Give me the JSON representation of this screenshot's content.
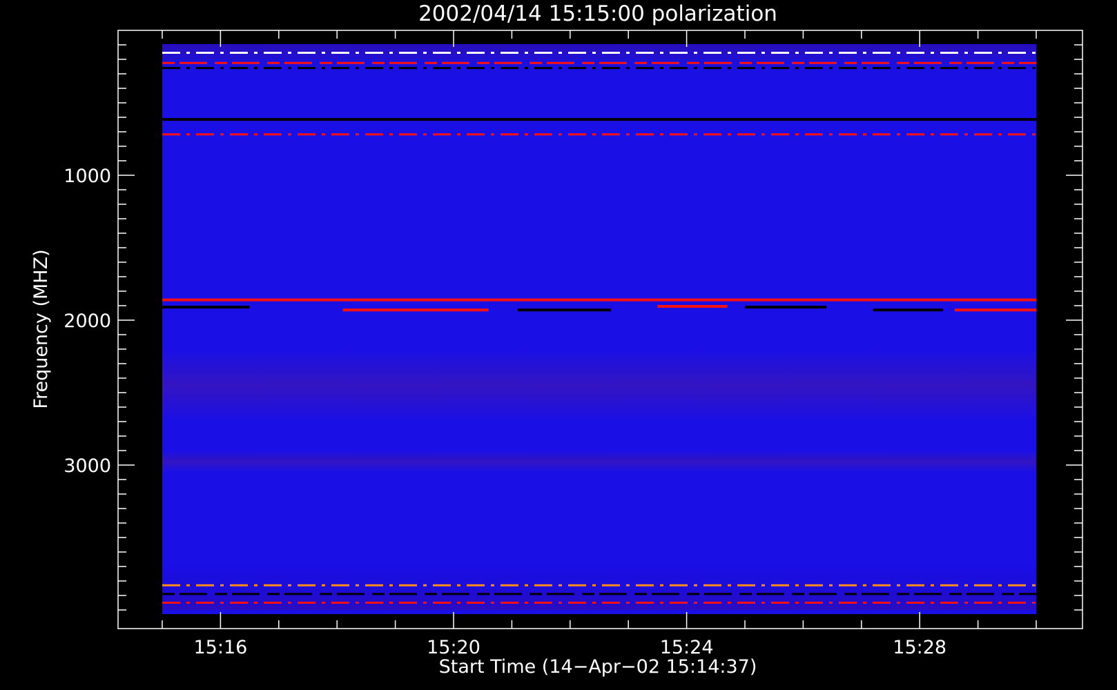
{
  "chart_data": {
    "type": "heatmap",
    "title": "2002/04/14 15:15:00 polarization",
    "xlabel": "Start Time (14−Apr−02 15:14:37)",
    "ylabel": "Frequency (MHZ)",
    "x_tick_labels": [
      "15:16",
      "15:20",
      "15:24",
      "15:28"
    ],
    "x_tick_values_min": [
      1,
      5,
      9,
      13
    ],
    "x_range_min": [
      0,
      15
    ],
    "y_tick_labels": [
      "1000",
      "2000",
      "3000"
    ],
    "y_tick_values": [
      1000,
      2000,
      3000
    ],
    "y_range": [
      0,
      4000
    ],
    "y_inverted": true,
    "data_extent_freq": [
      100,
      4000
    ],
    "grid": false,
    "colors": {
      "background": "#000000",
      "axes": "#ffffff",
      "base": "#1a10e6",
      "low_band": "#1208d8",
      "mid_band": "#2a14cc",
      "red": "#ff1010",
      "orange": "#ff8c1a",
      "white": "#ffffff",
      "dark": "#000000"
    },
    "features": [
      {
        "kind": "band",
        "freq_from": 100,
        "freq_to": 350,
        "shade": "noise_top"
      },
      {
        "kind": "line",
        "freq": 155,
        "t_from": 0,
        "t_to": 15,
        "color": "white",
        "pattern": "dashed"
      },
      {
        "kind": "line",
        "freq": 225,
        "t_from": 0,
        "t_to": 15,
        "color": "red",
        "pattern": "dashed"
      },
      {
        "kind": "line",
        "freq": 260,
        "t_from": 0,
        "t_to": 15,
        "color": "dark",
        "pattern": "dashed"
      },
      {
        "kind": "line",
        "freq": 615,
        "t_from": 0,
        "t_to": 15,
        "color": "dark",
        "pattern": "solid"
      },
      {
        "kind": "line",
        "freq": 718,
        "t_from": 0,
        "t_to": 15,
        "color": "red",
        "pattern": "dashed"
      },
      {
        "kind": "line",
        "freq": 1860,
        "t_from": 0,
        "t_to": 15,
        "color": "red",
        "pattern": "solid"
      },
      {
        "kind": "line",
        "freq": 1910,
        "t_from": 0,
        "t_to": 1.5,
        "color": "dark",
        "pattern": "solid"
      },
      {
        "kind": "line",
        "freq": 1930,
        "t_from": 3.1,
        "t_to": 5.6,
        "color": "red",
        "pattern": "solid"
      },
      {
        "kind": "line",
        "freq": 1930,
        "t_from": 6.1,
        "t_to": 7.7,
        "color": "dark",
        "pattern": "solid"
      },
      {
        "kind": "line",
        "freq": 1905,
        "t_from": 8.5,
        "t_to": 9.7,
        "color": "red",
        "pattern": "solid"
      },
      {
        "kind": "line",
        "freq": 1910,
        "t_from": 10.0,
        "t_to": 11.4,
        "color": "dark",
        "pattern": "solid"
      },
      {
        "kind": "line",
        "freq": 1930,
        "t_from": 12.2,
        "t_to": 13.4,
        "color": "dark",
        "pattern": "solid"
      },
      {
        "kind": "line",
        "freq": 1930,
        "t_from": 13.6,
        "t_to": 15.0,
        "color": "red",
        "pattern": "solid"
      },
      {
        "kind": "band",
        "freq_from": 2200,
        "freq_to": 2700,
        "shade": "mid_band"
      },
      {
        "kind": "band",
        "freq_from": 2900,
        "freq_to": 3050,
        "shade": "mid_band"
      },
      {
        "kind": "band",
        "freq_from": 3650,
        "freq_to": 4000,
        "shade": "noise_bottom"
      },
      {
        "kind": "line",
        "freq": 3830,
        "t_from": 0,
        "t_to": 15,
        "color": "orange",
        "pattern": "dashed"
      },
      {
        "kind": "line",
        "freq": 3890,
        "t_from": 0,
        "t_to": 15,
        "color": "dark",
        "pattern": "dashed"
      },
      {
        "kind": "line",
        "freq": 3950,
        "t_from": 0,
        "t_to": 15,
        "color": "red",
        "pattern": "dashed"
      }
    ]
  }
}
